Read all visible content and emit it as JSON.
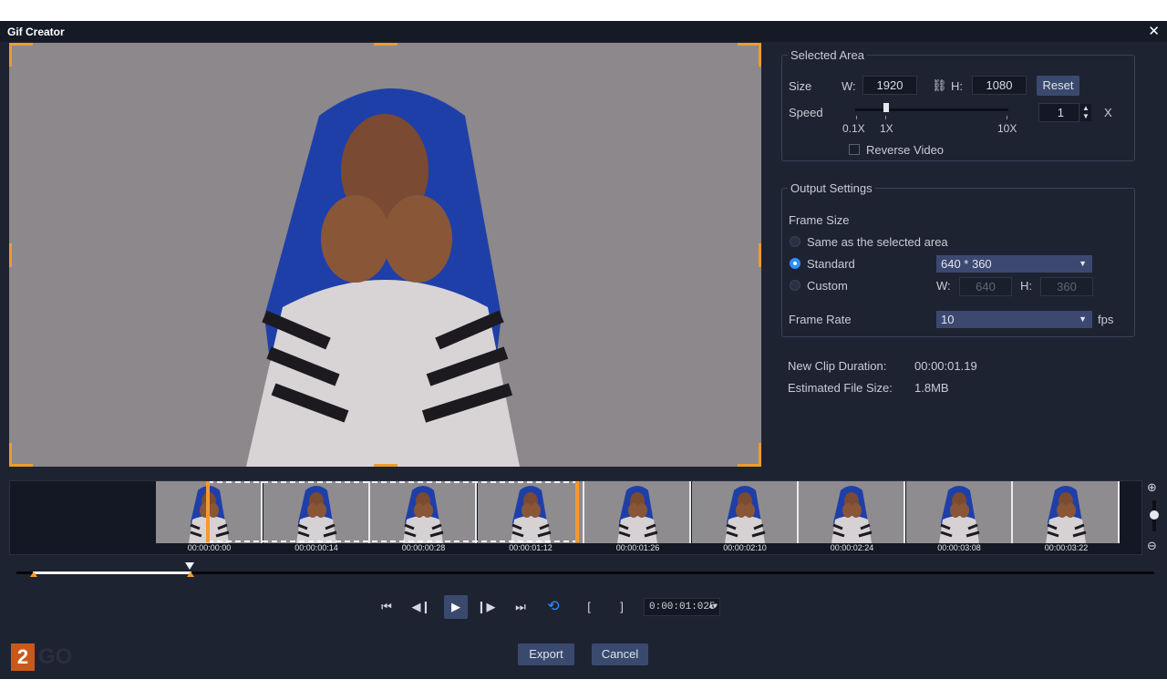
{
  "window": {
    "title": "Gif Creator",
    "close_glyph": "✕"
  },
  "selected_area": {
    "title": "Selected Area",
    "size_label": "Size",
    "w_label": "W:",
    "w_value": "1920",
    "link_icon": "chain-link-icon",
    "h_label": "H:",
    "h_value": "1080",
    "reset_label": "Reset",
    "speed_label": "Speed",
    "speed_ticks": [
      "0.1X",
      "1X",
      "10X"
    ],
    "speed_value": "1",
    "speed_unit": "X",
    "reverse_label": "Reverse Video",
    "reverse_checked": false
  },
  "output_settings": {
    "title": "Output Settings",
    "frame_size_label": "Frame Size",
    "options": [
      {
        "label": "Same as the selected area",
        "selected": false
      },
      {
        "label": "Standard",
        "selected": true
      },
      {
        "label": "Custom",
        "selected": false
      }
    ],
    "standard_value": "640 * 360",
    "custom_w_label": "W:",
    "custom_w_value": "640",
    "custom_h_label": "H:",
    "custom_h_value": "360",
    "frame_rate_label": "Frame Rate",
    "frame_rate_value": "10",
    "frame_rate_unit": "fps"
  },
  "summary": {
    "duration_label": "New Clip Duration:",
    "duration_value": "00:00:01.19",
    "filesize_label": "Estimated File Size:",
    "filesize_value": "1.8MB"
  },
  "timeline": {
    "frame_times": [
      "00:00:00:00",
      "00:00:00:14",
      "00:00:00:28",
      "00:00:01:12",
      "00:00:01:26",
      "00:00:02:10",
      "00:00:02:24",
      "00:00:03:08",
      "00:00:03:22"
    ],
    "zoom_in_icon": "zoom-in-icon",
    "zoom_out_icon": "zoom-out-icon"
  },
  "controls": {
    "timecode": "0:00:01:025",
    "mark_in": "[",
    "mark_out": "]"
  },
  "footer": {
    "export_label": "Export",
    "cancel_label": "Cancel",
    "logo_number": "2",
    "logo_text": "GO"
  },
  "colors": {
    "accent_orange": "#f29a2e",
    "background": "#1e2332",
    "button_blue": "#3a4a6e",
    "radio_selected": "#2f8fff",
    "loop_active": "#2f8fff"
  }
}
